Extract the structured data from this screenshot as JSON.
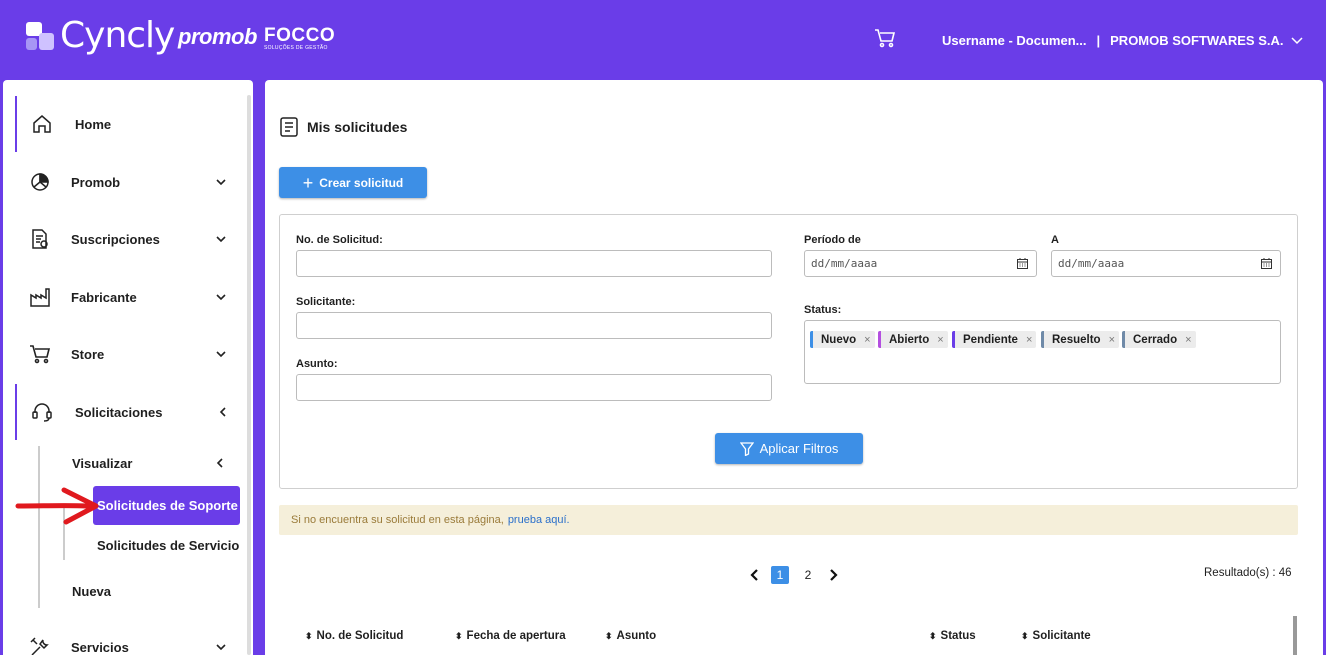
{
  "header": {
    "brand": "Cyncly",
    "brand_promob": "promob",
    "brand_focco": "FOCCO",
    "brand_focco_sub": "SOLUÇÕES DE GESTÃO",
    "user": "Username - Documen...",
    "separator": "|",
    "company": "PROMOB SOFTWARES S.A."
  },
  "sidebar": {
    "items": [
      {
        "label": "Home",
        "icon": "home-icon"
      },
      {
        "label": "Promob",
        "icon": "promob-icon"
      },
      {
        "label": "Suscripciones",
        "icon": "subscription-icon"
      },
      {
        "label": "Fabricante",
        "icon": "factory-icon"
      },
      {
        "label": "Store",
        "icon": "cart-icon"
      },
      {
        "label": "Solicitaciones",
        "icon": "headset-icon"
      },
      {
        "label": "Servicios",
        "icon": "tools-icon"
      }
    ],
    "sub": {
      "visualizar": "Visualizar",
      "soporte": "Solicitudes de Soporte",
      "servicio": "Solicitudes de Servicio",
      "nueva": "Nueva"
    }
  },
  "main": {
    "title": "Mis solicitudes",
    "create_button": "Crear solicitud",
    "filters": {
      "numero_label": "No. de Solicitud:",
      "solicitante_label": "Solicitante:",
      "asunto_label": "Asunto:",
      "periodo_label": "Período de",
      "a_label": "A",
      "date_placeholder": "dd/mm/aaaa",
      "status_label": "Status:",
      "chips": [
        {
          "label": "Nuevo",
          "color": "#3d8fe6"
        },
        {
          "label": "Abierto",
          "color": "#b44fe0"
        },
        {
          "label": "Pendiente",
          "color": "#6a3de8"
        },
        {
          "label": "Resuelto",
          "color": "#6f8aa8"
        },
        {
          "label": "Cerrado",
          "color": "#6f8aa8"
        }
      ],
      "chip_remove": "×",
      "apply_button": "Aplicar Filtros"
    },
    "notice": {
      "text": "Si no encuentra su solicitud en esta página,",
      "link": "prueba aquí."
    },
    "pagination": {
      "pages": [
        "1",
        "2"
      ],
      "current": "1"
    },
    "results": "Resultado(s) : 46",
    "table": {
      "columns": [
        "No. de Solicitud",
        "Fecha de apertura",
        "Asunto",
        "Status",
        "Solicitante"
      ]
    }
  },
  "colors": {
    "brand_purple": "#6a3de8",
    "primary_blue": "#3d8fe6",
    "annotation_red": "#e0191e"
  }
}
